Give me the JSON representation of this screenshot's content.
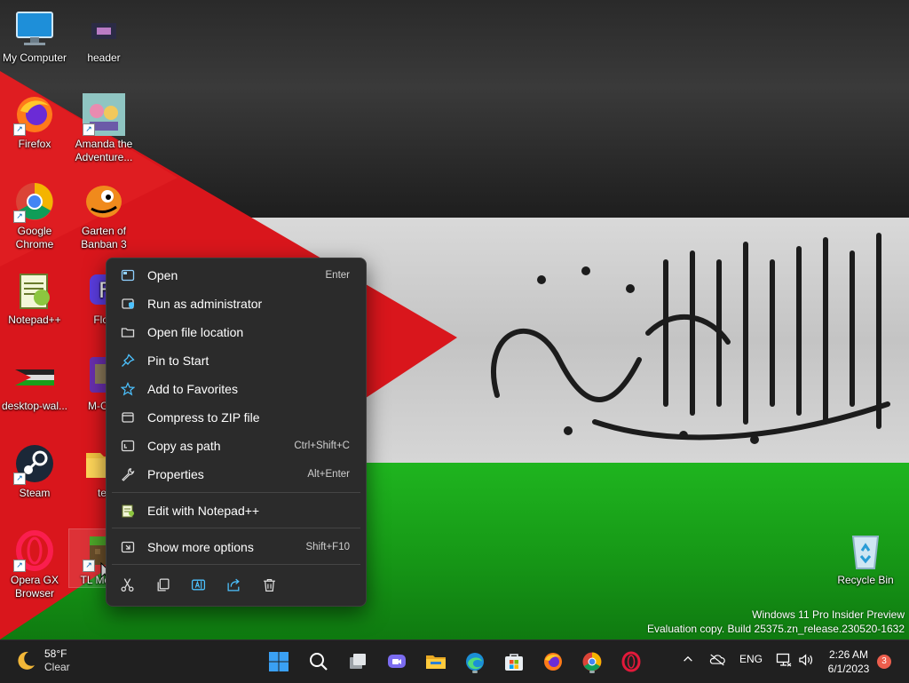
{
  "desktop": {
    "icons": [
      {
        "label": "My Computer",
        "icon": "computer-icon"
      },
      {
        "label": "header",
        "icon": "image-file-icon"
      },
      {
        "label": "Firefox",
        "icon": "firefox-icon"
      },
      {
        "label": "Amanda the Adventure...",
        "icon": "game-icon"
      },
      {
        "label": "Google Chrome",
        "icon": "chrome-icon"
      },
      {
        "label": "Garten of Banban 3",
        "icon": "game-icon"
      },
      {
        "label": "Notepad++",
        "icon": "notepadpp-icon"
      },
      {
        "label": "Floo",
        "icon": "app-icon"
      },
      {
        "label": "desktop-wal...",
        "icon": "image-file-icon"
      },
      {
        "label": "M-Cen",
        "icon": "app-icon"
      },
      {
        "label": "Steam",
        "icon": "steam-icon"
      },
      {
        "label": "ter",
        "icon": "folder-icon"
      },
      {
        "label": "Opera GX Browser",
        "icon": "opera-icon"
      },
      {
        "label": "TL Mc-lau",
        "icon": "minecraft-icon"
      },
      {
        "label": "Recycle Bin",
        "icon": "recycle-bin-icon"
      }
    ],
    "watermark": {
      "line1": "Windows 11 Pro Insider Preview",
      "line2": "Evaluation copy. Build 25375.zn_release.230520-1632"
    }
  },
  "context_menu": {
    "items": [
      {
        "label": "Open",
        "shortcut": "Enter",
        "icon": "open-icon"
      },
      {
        "label": "Run as administrator",
        "shortcut": "",
        "icon": "shield-icon"
      },
      {
        "label": "Open file location",
        "shortcut": "",
        "icon": "folder-icon"
      },
      {
        "label": "Pin to Start",
        "shortcut": "",
        "icon": "pin-icon"
      },
      {
        "label": "Add to Favorites",
        "shortcut": "",
        "icon": "star-icon"
      },
      {
        "label": "Compress to ZIP file",
        "shortcut": "",
        "icon": "zip-icon"
      },
      {
        "label": "Copy as path",
        "shortcut": "Ctrl+Shift+C",
        "icon": "copy-path-icon"
      },
      {
        "label": "Properties",
        "shortcut": "Alt+Enter",
        "icon": "wrench-icon"
      },
      {
        "label": "Edit with Notepad++",
        "shortcut": "",
        "icon": "notepadpp-icon"
      },
      {
        "label": "Show more options",
        "shortcut": "Shift+F10",
        "icon": "more-options-icon"
      }
    ],
    "quick_actions": [
      "cut-icon",
      "copy-icon",
      "rename-icon",
      "share-icon",
      "delete-icon"
    ]
  },
  "taskbar": {
    "weather": {
      "temp": "58°F",
      "condition": "Clear"
    },
    "apps": [
      "start-icon",
      "search-icon",
      "task-view-icon",
      "chat-icon",
      "file-explorer-icon",
      "edge-icon",
      "store-icon",
      "firefox-icon",
      "chrome-icon",
      "opera-icon"
    ],
    "tray": {
      "language": "ENG",
      "time": "2:26 AM",
      "date": "6/1/2023",
      "notification_count": "3"
    }
  },
  "colors": {
    "flag_red": "#d9161c",
    "flag_green": "#17a317",
    "menu_bg": "#2b2b2b",
    "accent": "#4cc2ff",
    "taskbar_bg": "#202020"
  }
}
